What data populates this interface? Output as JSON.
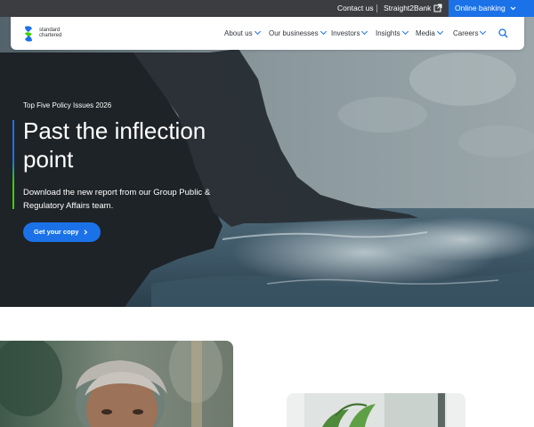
{
  "topbar": {
    "contact_label": "Contact us",
    "straight2bank_label": "Straight2Bank",
    "online_banking_label": "Online banking"
  },
  "brand": {
    "logo_line1": "standard",
    "logo_line2": "chartered"
  },
  "nav": {
    "items": [
      {
        "label": "About us"
      },
      {
        "label": "Our businesses"
      },
      {
        "label": "Investors"
      },
      {
        "label": "Insights"
      },
      {
        "label": "Media"
      },
      {
        "label": "Careers"
      }
    ]
  },
  "hero": {
    "eyebrow": "Top Five Policy Issues 2026",
    "headline": "Past the inflection point",
    "subline": "Download the new report from our Group Public & Regulatory Affairs team.",
    "cta_label": "Get your copy"
  },
  "colors": {
    "brand_blue": "#1b72e8",
    "brand_green": "#38d200",
    "topbar_bg": "#3b3d40"
  },
  "icons": [
    "external-link-icon",
    "chevron-down-icon",
    "search-icon",
    "chevron-right-icon"
  ]
}
